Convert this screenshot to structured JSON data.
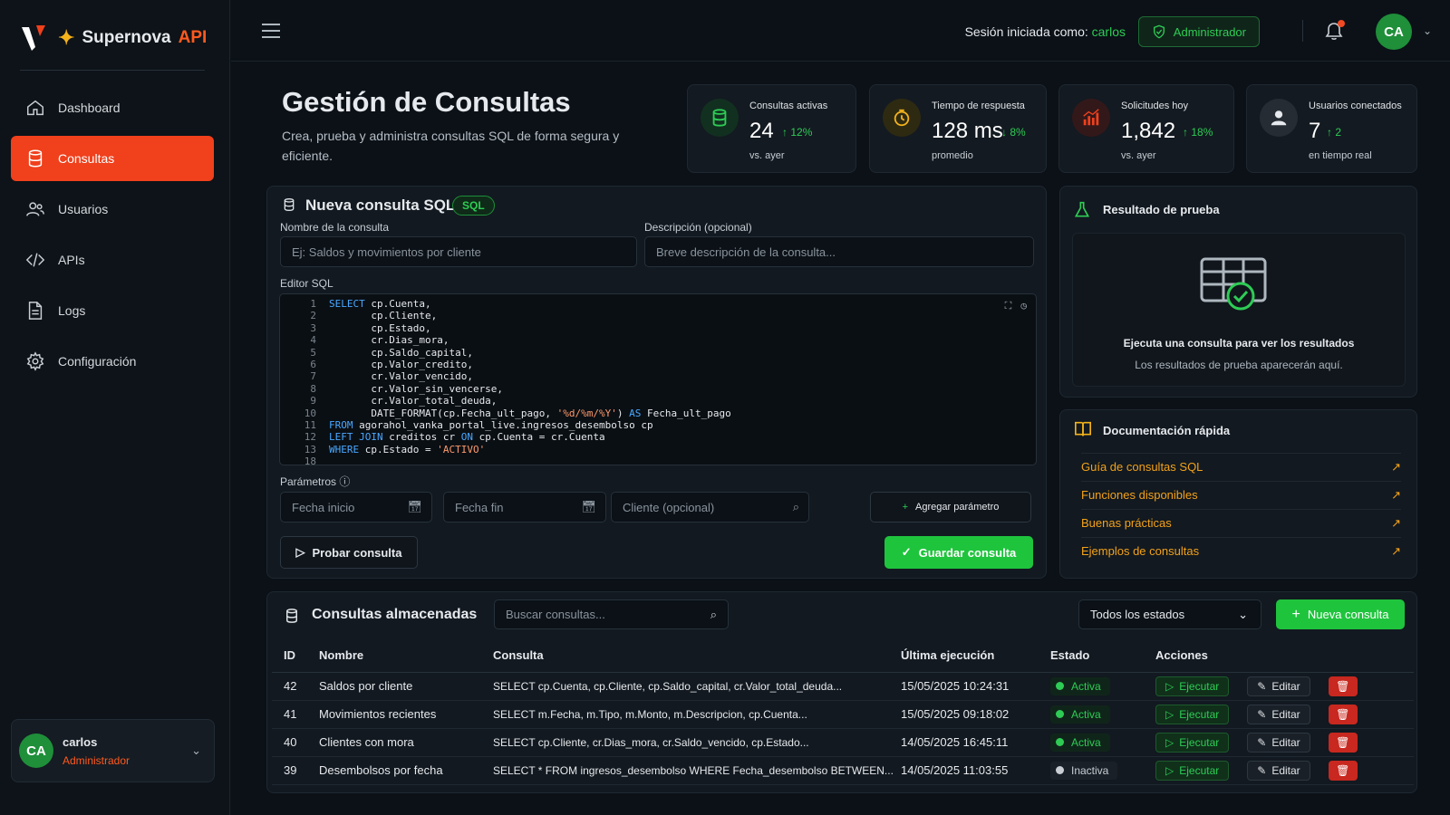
{
  "brand": {
    "name": "Supernova",
    "suffix": "API"
  },
  "nav": [
    {
      "label": "Dashboard",
      "icon": "home-icon"
    },
    {
      "label": "Consultas",
      "icon": "database-icon",
      "active": true
    },
    {
      "label": "Usuarios",
      "icon": "users-icon"
    },
    {
      "label": "APIs",
      "icon": "code-icon"
    },
    {
      "label": "Logs",
      "icon": "file-icon"
    },
    {
      "label": "Configuración",
      "icon": "gear-icon"
    }
  ],
  "user": {
    "initials": "CA",
    "name": "carlos",
    "role": "Administrador"
  },
  "topbar": {
    "session_prefix": "Sesión iniciada como:",
    "session_user": "carlos",
    "role_badge": "Administrador"
  },
  "header": {
    "title": "Gestión de Consultas",
    "subtitle": "Crea, prueba y administra consultas SQL de forma segura y eficiente."
  },
  "stats": [
    {
      "label": "Consultas activas",
      "value": "24",
      "delta": "12%",
      "note": "vs. ayer",
      "color": "#2ecc55"
    },
    {
      "label": "Tiempo de respuesta",
      "value": "128 ms",
      "delta": "8%",
      "note": "promedio",
      "color": "#f3b21a"
    },
    {
      "label": "Solicitudes hoy",
      "value": "1,842",
      "delta": "18%",
      "note": "vs. ayer",
      "color": "#f0401c"
    },
    {
      "label": "Usuarios conectados",
      "value": "7",
      "delta": "2",
      "note": "en tiempo real",
      "color": "#e6e9ed"
    }
  ],
  "new_query": {
    "title": "Nueva consulta SQL",
    "badge": "SQL",
    "name_label": "Nombre de la consulta",
    "name_placeholder": "Ej: Saldos y movimientos por cliente",
    "desc_label": "Descripción (opcional)",
    "desc_placeholder": "Breve descripción de la consulta...",
    "editor_label": "Editor SQL",
    "params_label": "Parámetros",
    "param_start": "Fecha inicio",
    "param_end": "Fecha fin",
    "param_client": "Cliente (opcional)",
    "add_param": "Agregar parámetro",
    "test_button": "Probar consulta",
    "save_button": "Guardar consulta"
  },
  "sql_lines": [
    {
      "n": "1",
      "t": "SELECT cp.Cuenta,"
    },
    {
      "n": "2",
      "t": "       cp.Cliente,"
    },
    {
      "n": "3",
      "t": "       cp.Estado,"
    },
    {
      "n": "4",
      "t": "       cr.Dias_mora,"
    },
    {
      "n": "5",
      "t": "       cp.Saldo_capital,"
    },
    {
      "n": "6",
      "t": "       cp.Valor_credito,"
    },
    {
      "n": "7",
      "t": "       cr.Valor_vencido,"
    },
    {
      "n": "8",
      "t": "       cr.Valor_sin_vencerse,"
    },
    {
      "n": "9",
      "t": "       cr.Valor_total_deuda,"
    },
    {
      "n": "10",
      "t": "       DATE_FORMAT(cp.Fecha_ult_pago, '%d/%m/%Y') AS Fecha_ult_pago"
    },
    {
      "n": "11",
      "t": "FROM agorahol_vanka_portal_live.ingresos_desembolso cp"
    },
    {
      "n": "12",
      "t": "LEFT JOIN creditos cr ON cp.Cuenta = cr.Cuenta"
    },
    {
      "n": "13",
      "t": "WHERE cp.Estado = 'ACTIVO'"
    },
    {
      "n": "18",
      "t": ""
    }
  ],
  "result": {
    "title": "Resultado de prueba",
    "empty_title": "Ejecuta una consulta para ver los resultados",
    "empty_sub": "Los resultados de prueba aparecerán aquí."
  },
  "docs": {
    "title": "Documentación rápida",
    "links": [
      "Guía de consultas SQL",
      "Funciones disponibles",
      "Buenas prácticas",
      "Ejemplos de consultas"
    ]
  },
  "stored": {
    "title": "Consultas almacenadas",
    "search_placeholder": "Buscar consultas...",
    "filter": "Todos los estados",
    "new_button": "Nueva consulta",
    "columns": [
      "ID",
      "Nombre",
      "Consulta",
      "Última ejecución",
      "Estado",
      "Acciones"
    ],
    "actions": {
      "run": "Ejecutar",
      "edit": "Editar"
    },
    "rows": [
      {
        "id": "42",
        "name": "Saldos por cliente",
        "query": "SELECT cp.Cuenta, cp.Cliente, cp.Saldo_capital, cr.Valor_total_deuda...",
        "last": "15/05/2025 10:24:31",
        "status": "Activa",
        "active": true
      },
      {
        "id": "41",
        "name": "Movimientos recientes",
        "query": "SELECT m.Fecha, m.Tipo, m.Monto, m.Descripcion, cp.Cuenta...",
        "last": "15/05/2025 09:18:02",
        "status": "Activa",
        "active": true
      },
      {
        "id": "40",
        "name": "Clientes con mora",
        "query": "SELECT cp.Cliente, cr.Dias_mora, cr.Saldo_vencido, cp.Estado...",
        "last": "14/05/2025 16:45:11",
        "status": "Activa",
        "active": true
      },
      {
        "id": "39",
        "name": "Desembolsos por fecha",
        "query": "SELECT * FROM ingresos_desembolso WHERE Fecha_desembolso BETWEEN...",
        "last": "14/05/2025 11:03:55",
        "status": "Inactiva",
        "active": false
      }
    ]
  }
}
